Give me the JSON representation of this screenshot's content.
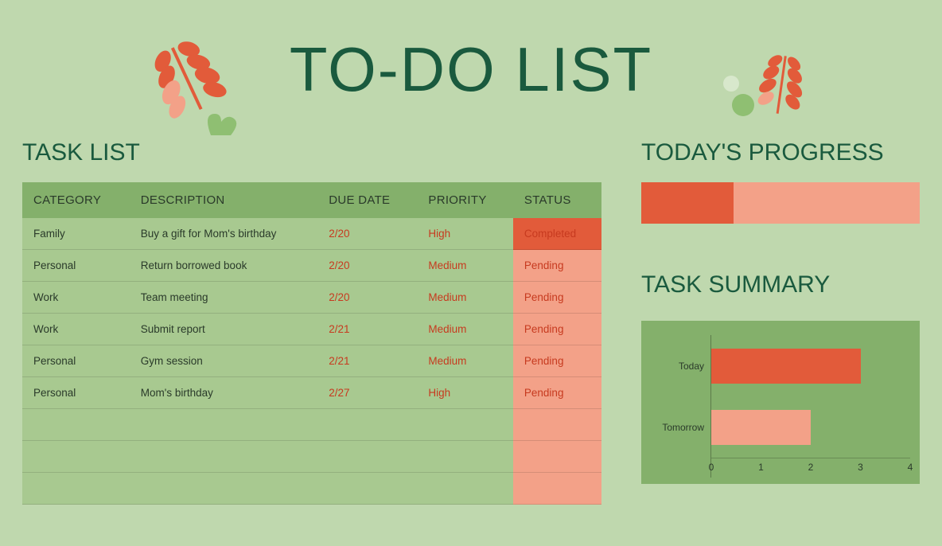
{
  "title": "TO-DO LIST",
  "task_list_heading": "TASK LIST",
  "progress_heading": "TODAY'S PROGRESS",
  "summary_heading": "TASK SUMMARY",
  "columns": {
    "category": "CATEGORY",
    "description": "DESCRIPTION",
    "due_date": "DUE DATE",
    "priority": "PRIORITY",
    "status": "STATUS"
  },
  "tasks": [
    {
      "category": "Family",
      "description": "Buy a gift for Mom's birthday",
      "due_date": "2/20",
      "priority": "High",
      "status": "Completed"
    },
    {
      "category": "Personal",
      "description": "Return borrowed book",
      "due_date": "2/20",
      "priority": "Medium",
      "status": "Pending"
    },
    {
      "category": "Work",
      "description": "Team meeting",
      "due_date": "2/20",
      "priority": "Medium",
      "status": "Pending"
    },
    {
      "category": "Work",
      "description": "Submit report",
      "due_date": "2/21",
      "priority": "Medium",
      "status": "Pending"
    },
    {
      "category": "Personal",
      "description": "Gym session",
      "due_date": "2/21",
      "priority": "Medium",
      "status": "Pending"
    },
    {
      "category": "Personal",
      "description": "Mom's birthday",
      "due_date": "2/27",
      "priority": "High",
      "status": "Pending"
    }
  ],
  "empty_rows": 3,
  "progress_percent": 33,
  "chart_data": {
    "type": "bar",
    "orientation": "horizontal",
    "categories": [
      "Today",
      "Tomorrow"
    ],
    "values": [
      3,
      2
    ],
    "colors": [
      "#e25b3a",
      "#f3a188"
    ],
    "xlim": [
      0,
      4
    ],
    "ticks": [
      0,
      1,
      2,
      3,
      4
    ],
    "title": "",
    "xlabel": "",
    "ylabel": ""
  },
  "colors": {
    "accent_dark": "#1a5a3e",
    "accent_orange": "#e25b3a",
    "accent_salmon": "#f3a188",
    "panel_green": "#84b06b"
  }
}
